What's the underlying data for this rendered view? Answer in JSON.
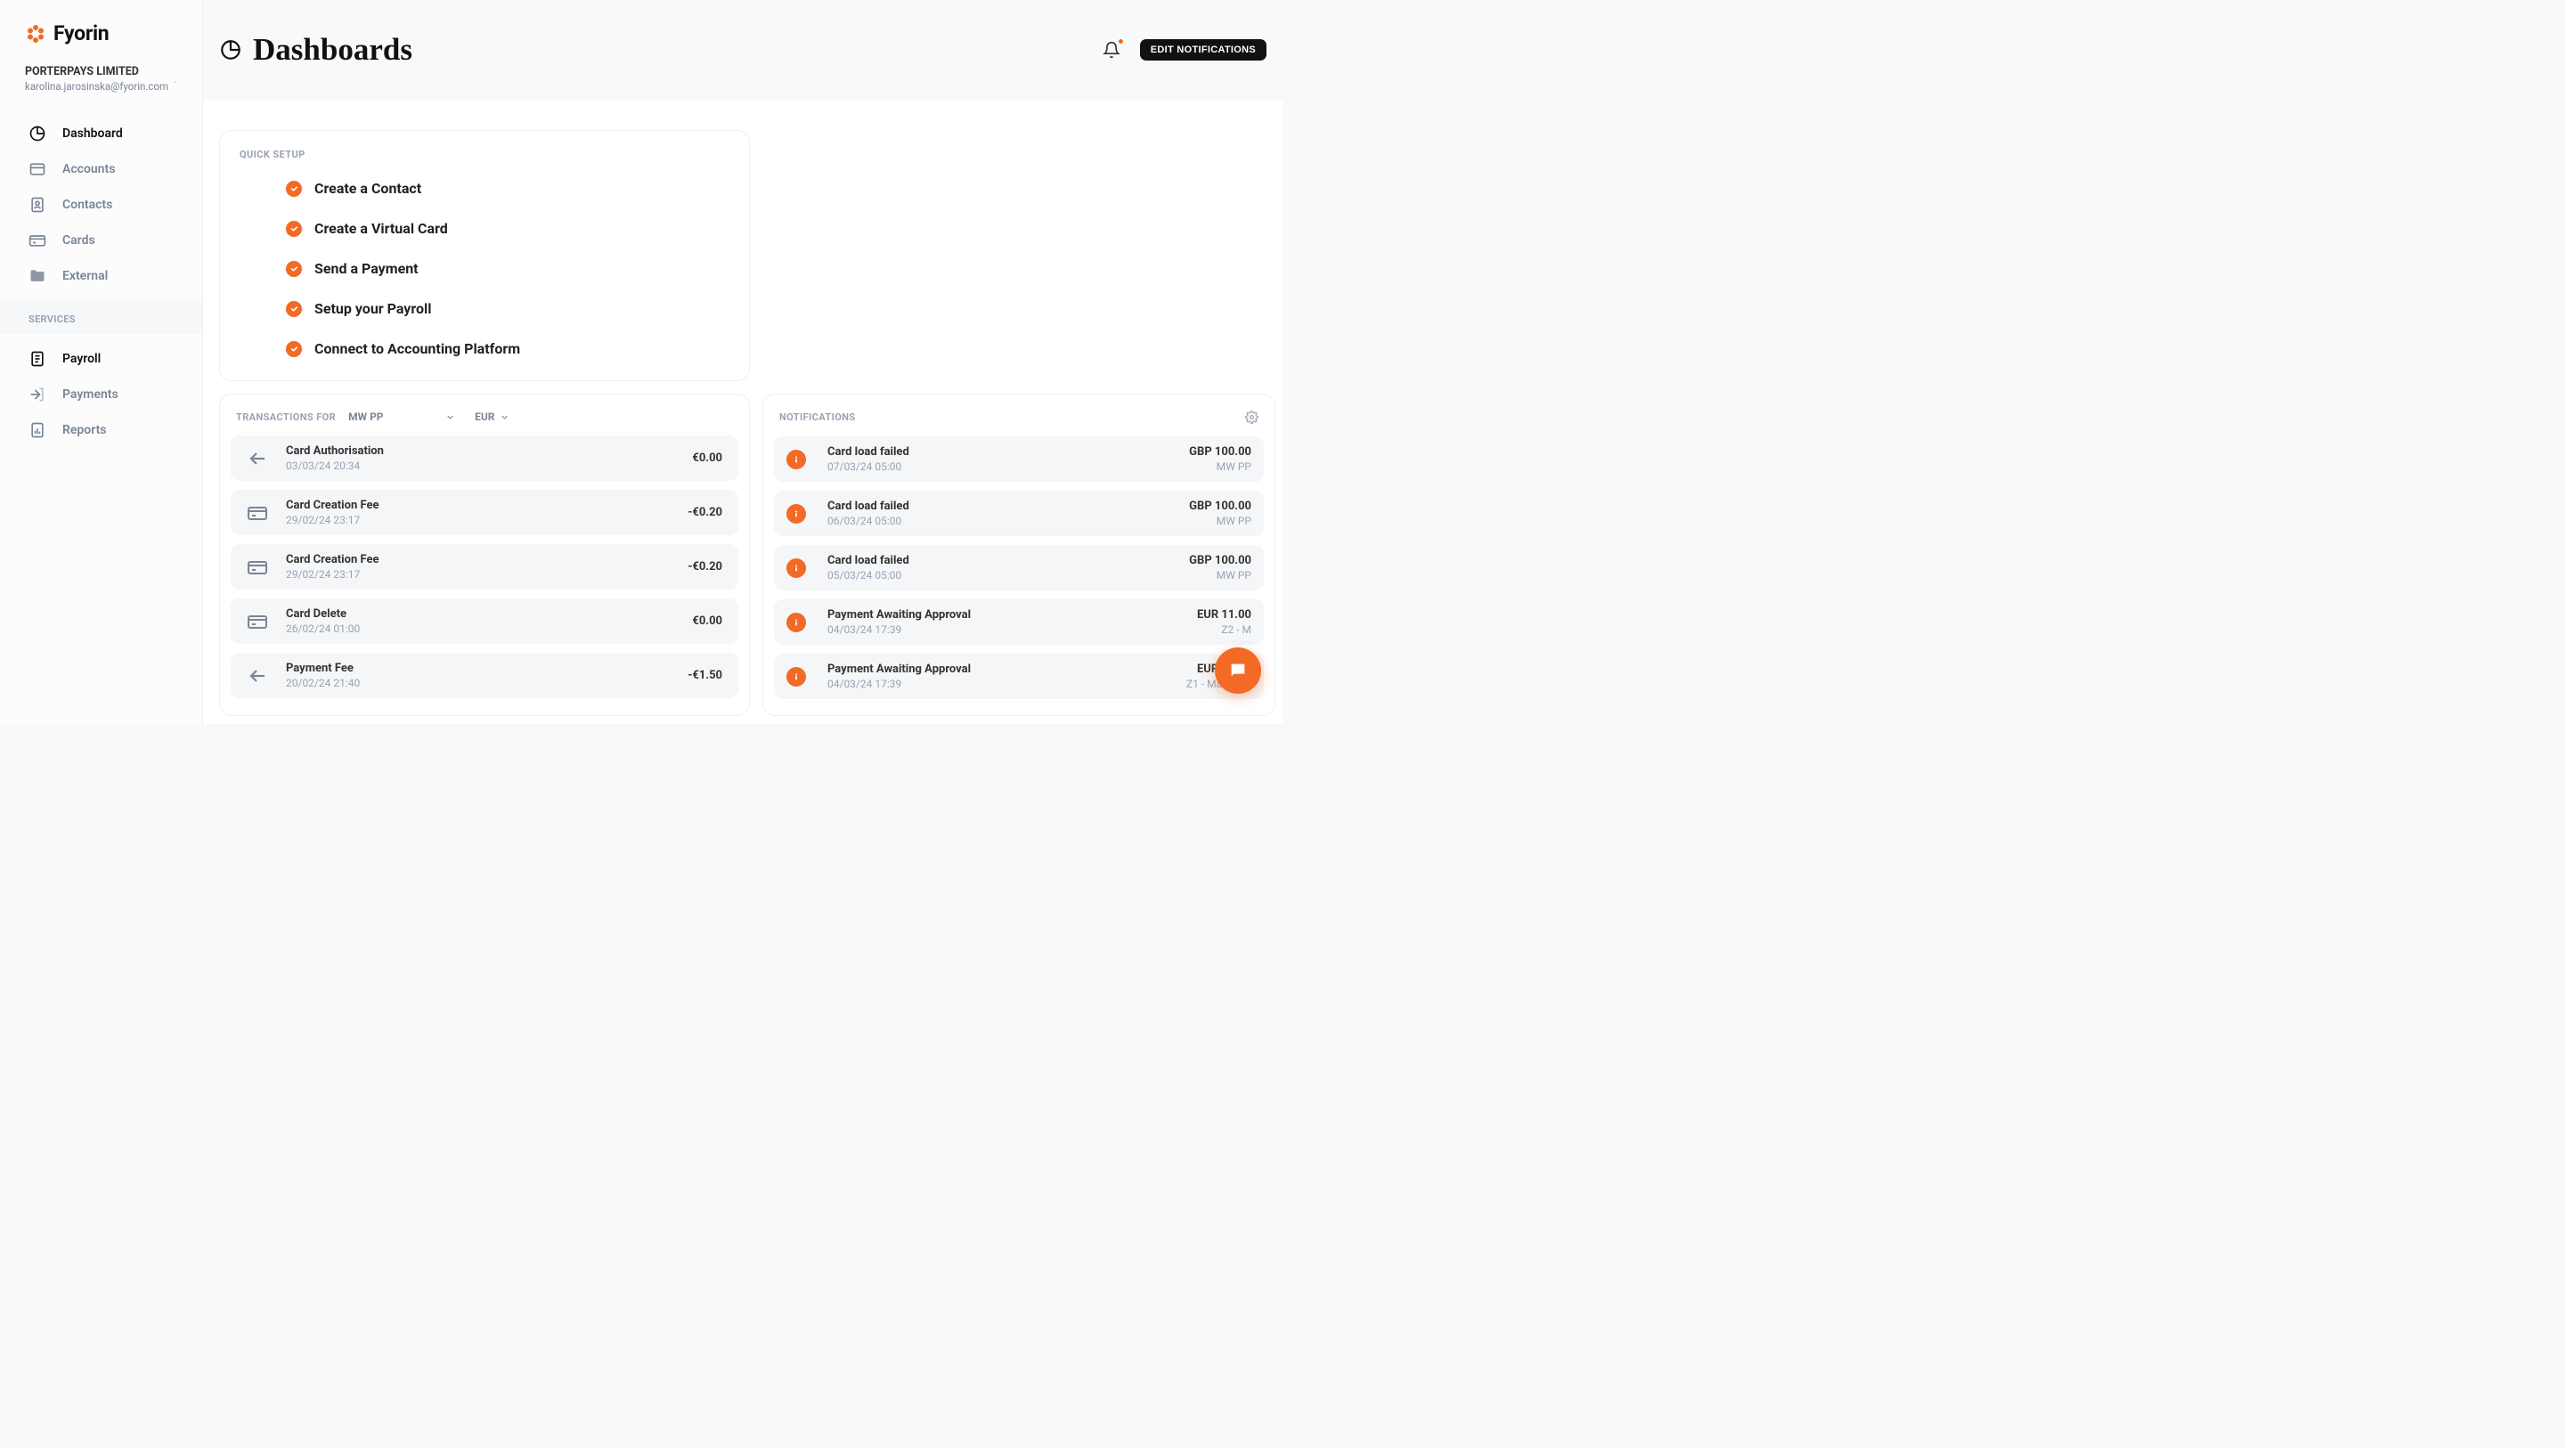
{
  "brand": {
    "name": "Fyorin"
  },
  "account": {
    "company": "PORTERPAYS LIMITED",
    "email": "karolina.jarosinska@fyorin.com"
  },
  "nav": {
    "items": [
      {
        "label": "Dashboard",
        "icon": "pie-chart-icon",
        "active": true
      },
      {
        "label": "Accounts",
        "icon": "window-icon",
        "active": false
      },
      {
        "label": "Contacts",
        "icon": "contact-icon",
        "active": false
      },
      {
        "label": "Cards",
        "icon": "card-icon",
        "active": false
      },
      {
        "label": "External",
        "icon": "folder-icon",
        "active": false
      }
    ],
    "services_label": "SERVICES",
    "services": [
      {
        "label": "Payroll",
        "icon": "document-icon",
        "active": true
      },
      {
        "label": "Payments",
        "icon": "send-out-icon",
        "active": false
      },
      {
        "label": "Reports",
        "icon": "bar-doc-icon",
        "active": false
      }
    ]
  },
  "header": {
    "title": "Dashboards",
    "edit_notifications_label": "EDIT NOTIFICATIONS"
  },
  "quick_setup": {
    "label": "QUICK SETUP",
    "items": [
      "Create a Contact",
      "Create a Virtual Card",
      "Send a Payment",
      "Setup your Payroll",
      "Connect to Accounting Platform"
    ]
  },
  "transactions": {
    "label": "TRANSACTIONS FOR",
    "account_selector": "MW PP",
    "currency_selector": "EUR",
    "rows": [
      {
        "icon": "arrow-left-icon",
        "title": "Card Authorisation",
        "date": "03/03/24 20:34",
        "amount": "€0.00"
      },
      {
        "icon": "card-icon",
        "title": "Card Creation Fee",
        "date": "29/02/24 23:17",
        "amount": "-€0.20"
      },
      {
        "icon": "card-icon",
        "title": "Card Creation Fee",
        "date": "29/02/24 23:17",
        "amount": "-€0.20"
      },
      {
        "icon": "card-icon",
        "title": "Card Delete",
        "date": "26/02/24 01:00",
        "amount": "€0.00"
      },
      {
        "icon": "arrow-left-icon",
        "title": "Payment Fee",
        "date": "20/02/24 21:40",
        "amount": "-€1.50"
      }
    ]
  },
  "notifications": {
    "label": "NOTIFICATIONS",
    "rows": [
      {
        "title": "Card load failed",
        "date": "07/03/24 05:00",
        "amount": "GBP 100.00",
        "account": "MW PP"
      },
      {
        "title": "Card load failed",
        "date": "06/03/24 05:00",
        "amount": "GBP 100.00",
        "account": "MW PP"
      },
      {
        "title": "Card load failed",
        "date": "05/03/24 05:00",
        "amount": "GBP 100.00",
        "account": "MW PP"
      },
      {
        "title": "Payment Awaiting Approval",
        "date": "04/03/24 17:39",
        "amount": "EUR 11.00",
        "account": "Z2 - M"
      },
      {
        "title": "Payment Awaiting Approval",
        "date": "04/03/24 17:39",
        "amount": "EUR 10.00",
        "account": "Z1 - Main Acc"
      }
    ]
  },
  "colors": {
    "accent": "#f26a25"
  }
}
